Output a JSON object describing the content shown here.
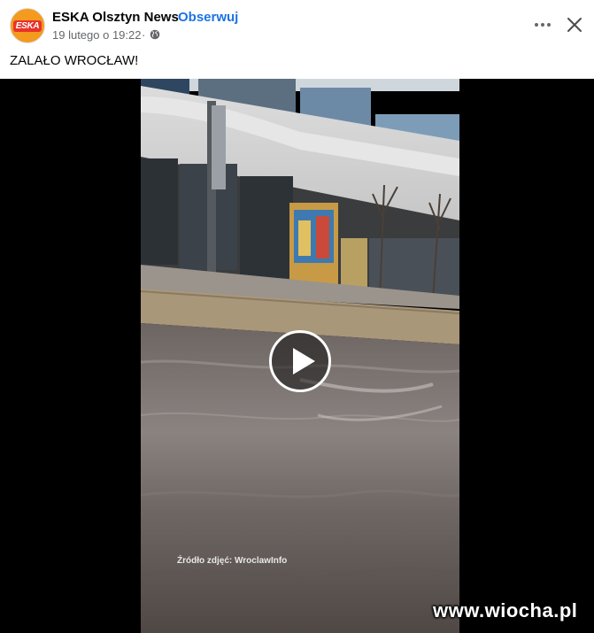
{
  "post": {
    "page_name": "ESKA Olsztyn News",
    "separator": "·",
    "follow_label": "Obserwuj",
    "timestamp": "19 lutego o 19:22",
    "time_separator": "·",
    "avatar_text": "ESKA",
    "text": "ZALAŁO WROCŁAW!",
    "privacy_icon": "globe-icon",
    "more_icon": "more-horizontal-icon",
    "close_icon": "close-icon"
  },
  "video": {
    "play_icon": "play-icon",
    "source_caption": "Źródło zdjęć: WroclawInfo",
    "watermark": "www.wiocha.pl"
  },
  "colors": {
    "link": "#1b74e4",
    "secondary_text": "#65676b",
    "avatar_bg": "#f39a1f",
    "avatar_logo": "#e8322b"
  }
}
